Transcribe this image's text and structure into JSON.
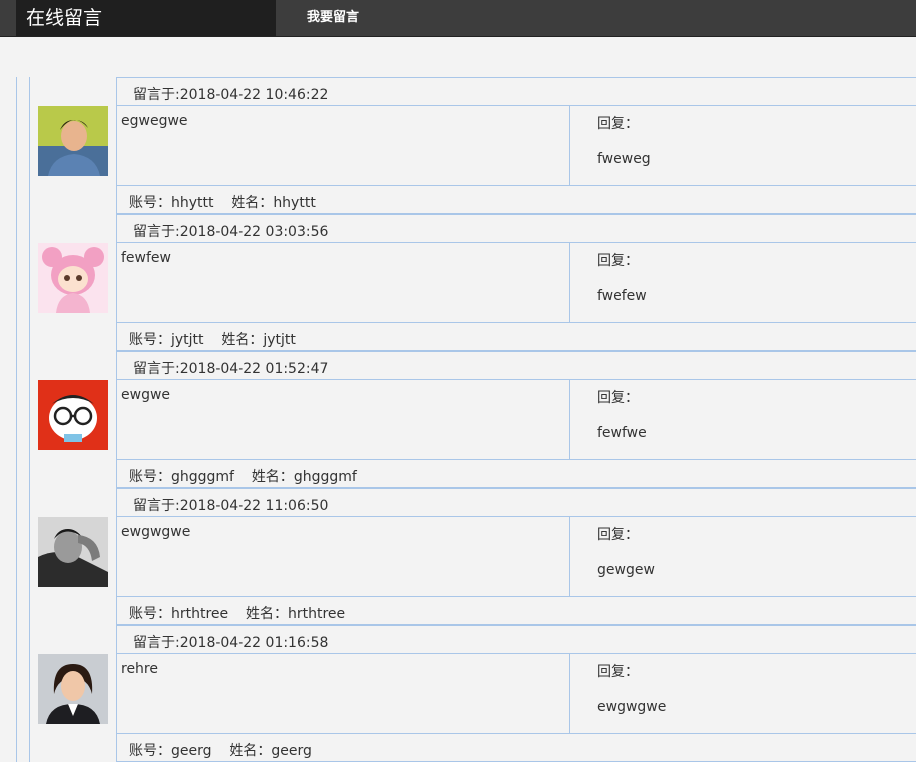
{
  "header": {
    "brand": "在线留言",
    "nav_leave_message": "我要留言"
  },
  "labels": {
    "time_prefix": "留言于:",
    "reply": "回复：",
    "account_prefix": "账号：",
    "name_prefix": "姓名："
  },
  "messages": [
    {
      "time": "2018-04-22 10:46:22",
      "content": "egwegwe",
      "reply": "fweweg",
      "account": "hhyttt",
      "name": "hhyttt",
      "avatar": "man-portrait"
    },
    {
      "time": "2018-04-22 03:03:56",
      "content": "fewfew",
      "reply": "fwefew",
      "account": "jytjtt",
      "name": "jytjtt",
      "avatar": "cartoon-girl-pink-hood"
    },
    {
      "time": "2018-04-22 01:52:47",
      "content": "ewgwe",
      "reply": "fewfwe",
      "account": "ghgggmf",
      "name": "ghgggmf",
      "avatar": "cartoon-glasses-face"
    },
    {
      "time": "2018-04-22 11:06:50",
      "content": "ewgwgwe",
      "reply": "gewgew",
      "account": "hrthtree",
      "name": "hrthtree",
      "avatar": "man-bw-portrait"
    },
    {
      "time": "2018-04-22 01:16:58",
      "content": "rehre",
      "reply": "ewgwgwe",
      "account": "geerg",
      "name": "geerg",
      "avatar": "woman-portrait"
    }
  ]
}
